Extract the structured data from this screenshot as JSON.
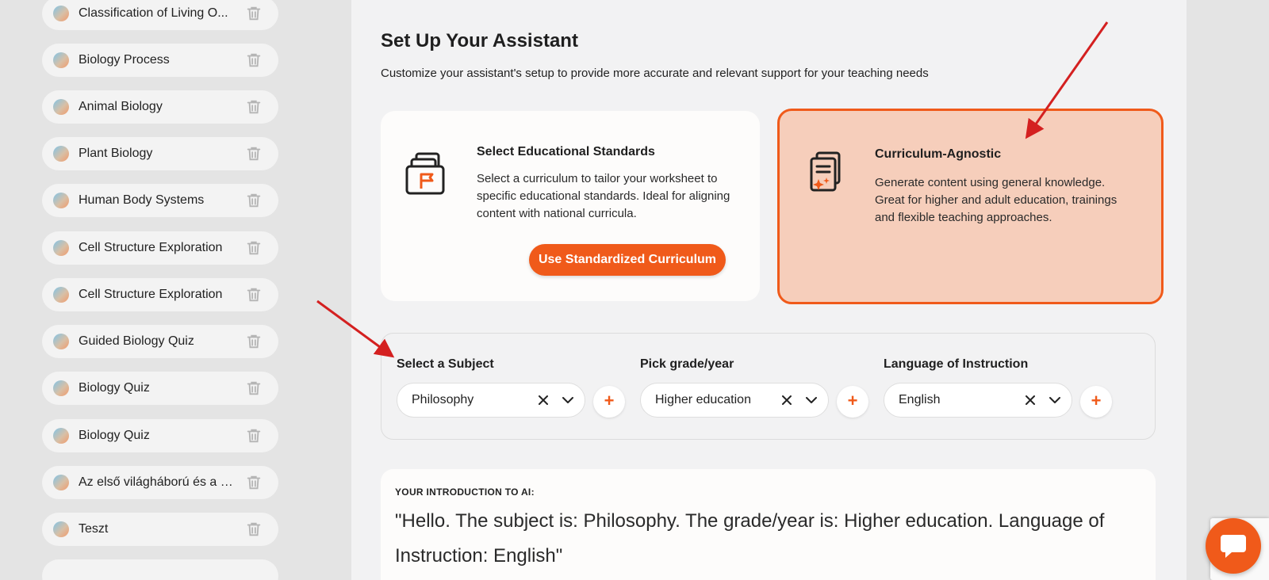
{
  "sidebar": {
    "items": [
      {
        "label": "Classification of Living O..."
      },
      {
        "label": "Biology Process"
      },
      {
        "label": "Animal Biology"
      },
      {
        "label": "Plant Biology"
      },
      {
        "label": "Human Body Systems"
      },
      {
        "label": "Cell Structure Exploration"
      },
      {
        "label": "Cell Structure Exploration"
      },
      {
        "label": "Guided Biology Quiz"
      },
      {
        "label": "Biology Quiz"
      },
      {
        "label": "Biology Quiz"
      },
      {
        "label": "Az első világháború és a g..."
      },
      {
        "label": "Teszt"
      }
    ]
  },
  "main": {
    "title": "Set Up Your Assistant",
    "subtitle": "Customize your assistant's setup to provide more accurate and relevant support for your teaching needs",
    "standards_card": {
      "title": "Select Educational Standards",
      "description": "Select a curriculum to tailor your worksheet to specific educational standards. Ideal for aligning content with national curricula.",
      "button_label": "Use Standardized Curriculum"
    },
    "agnostic_card": {
      "title": "Curriculum-Agnostic",
      "description": "Generate content using general knowledge. Great for higher and adult education, trainings and flexible teaching approaches.",
      "selected": true
    },
    "selectors": {
      "subject": {
        "label": "Select a Subject",
        "value": "Philosophy",
        "add": "+"
      },
      "grade": {
        "label": "Pick grade/year",
        "value": "Higher education",
        "add": "+"
      },
      "language": {
        "label": "Language of Instruction",
        "value": "English",
        "add": "+"
      }
    },
    "intro": {
      "label": "YOUR INTRODUCTION TO AI:",
      "text": "\"Hello. The subject is: Philosophy. The grade/year is: Higher education. Language of Instruction: English\""
    }
  },
  "colors": {
    "accent": "#f05a1a",
    "selected_card_bg": "#f6cebb",
    "arrow": "#d42020"
  },
  "icons": [
    "trash-icon",
    "folder-flag-icon",
    "documents-sparkle-icon",
    "clear-x-icon",
    "chevron-down-icon",
    "plus-icon",
    "chat-icon"
  ]
}
